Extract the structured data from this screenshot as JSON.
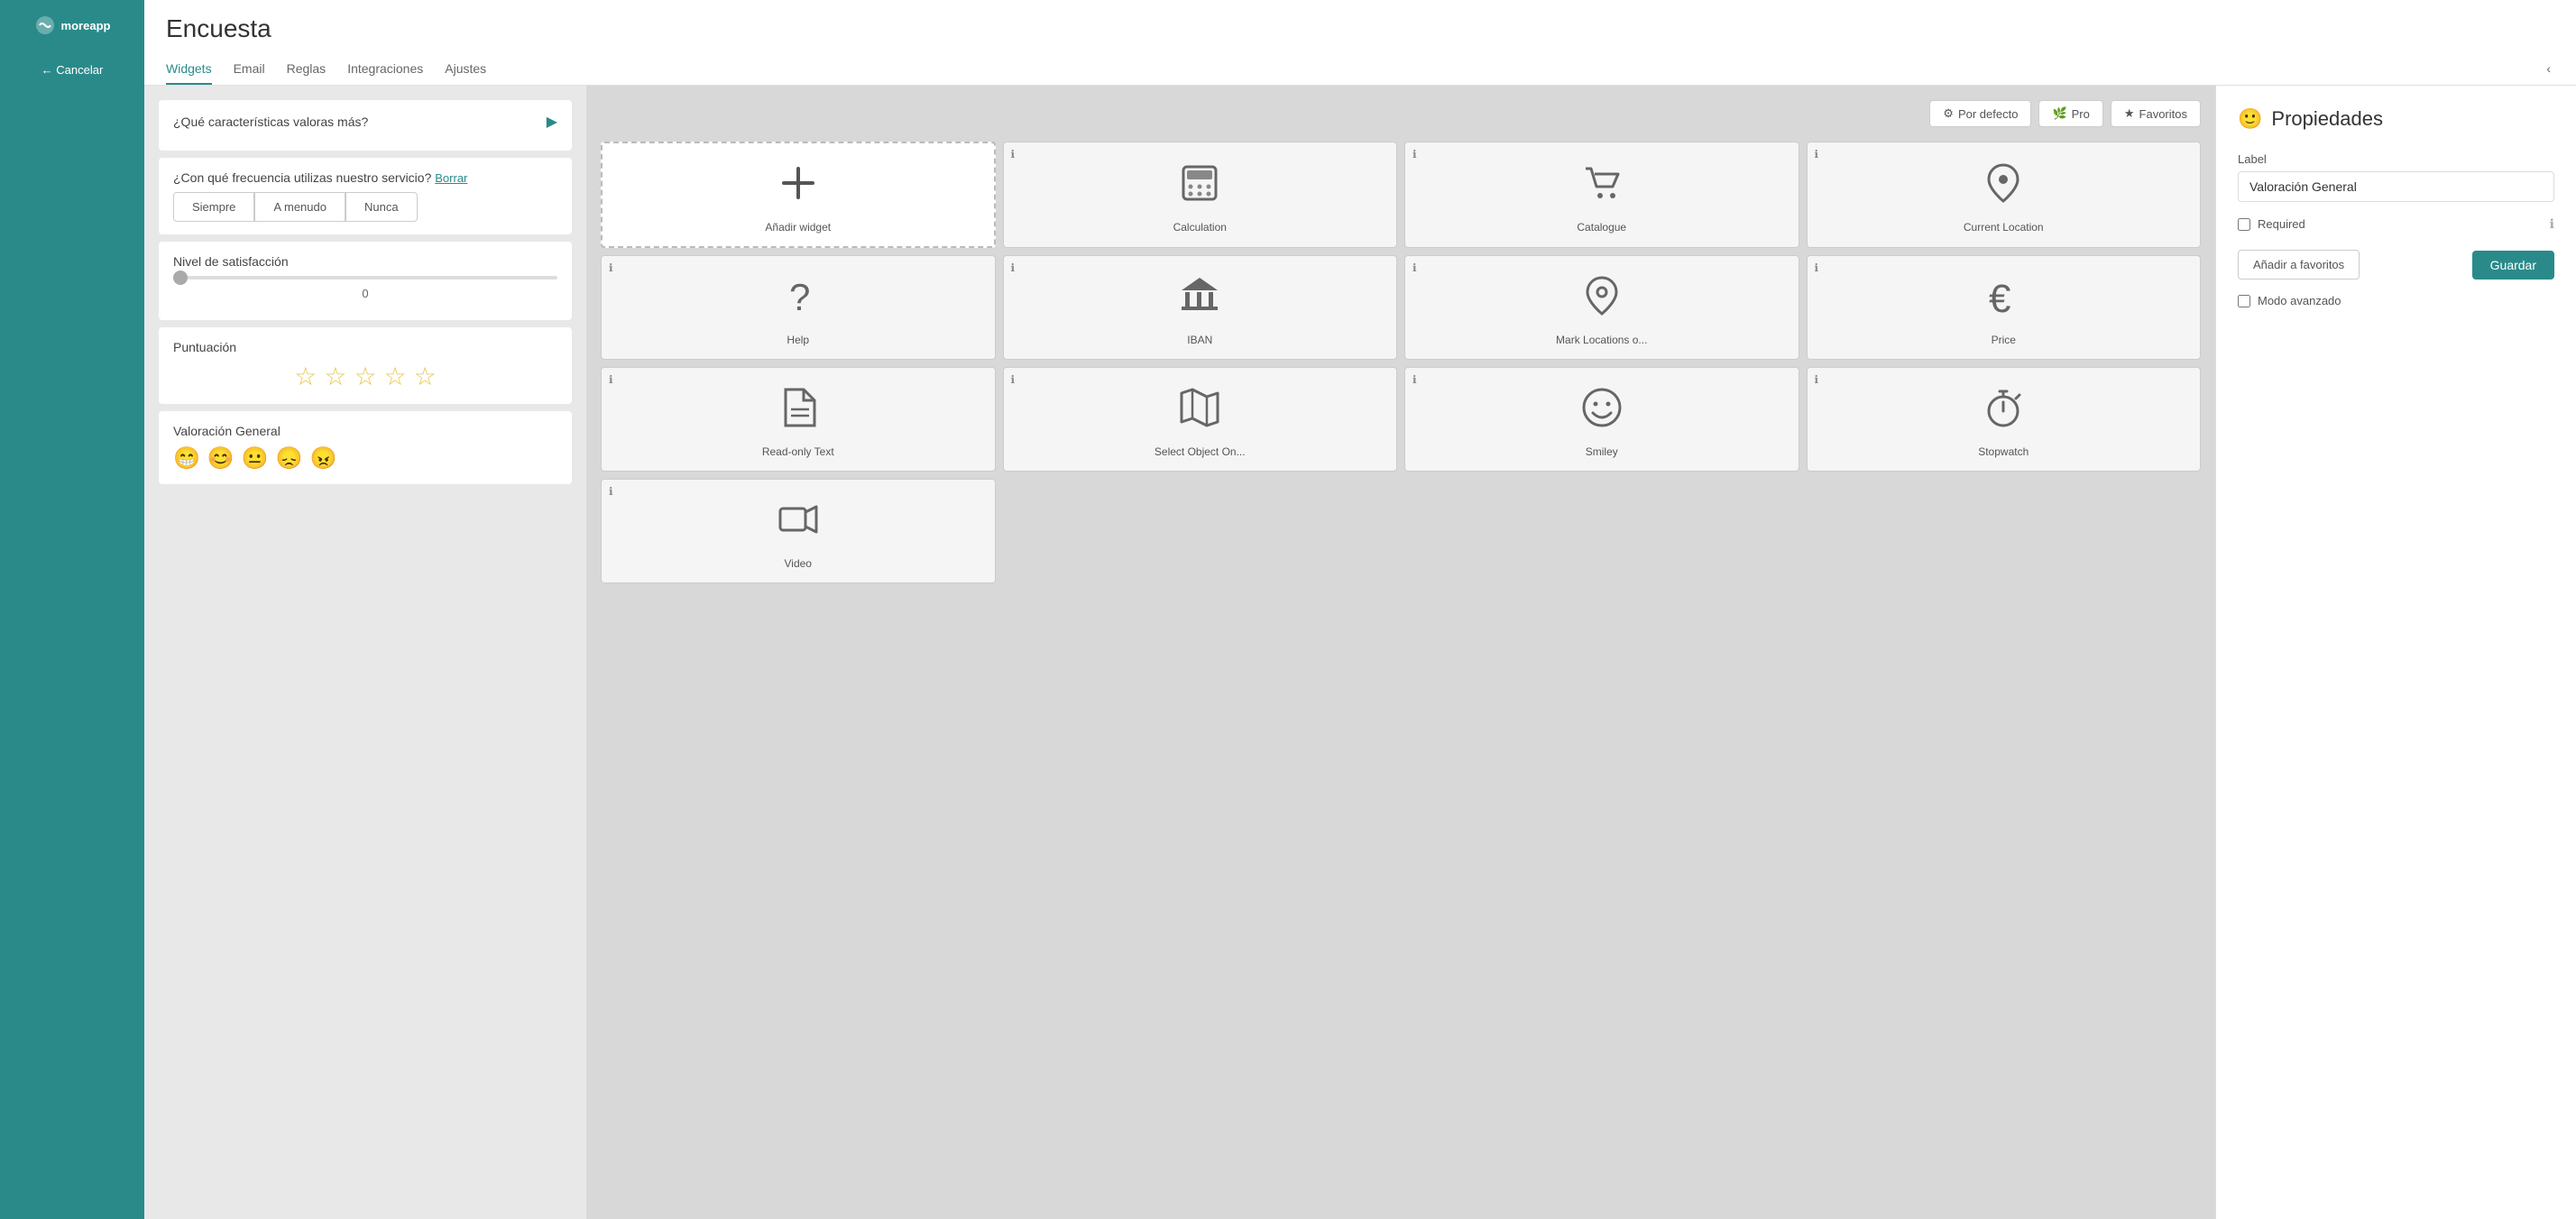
{
  "app": {
    "logo_text": "moreapp",
    "page_title": "Encuesta"
  },
  "sidebar": {
    "cancel_label": "← Cancelar"
  },
  "tabs": [
    {
      "id": "widgets",
      "label": "Widgets",
      "active": true
    },
    {
      "id": "email",
      "label": "Email",
      "active": false
    },
    {
      "id": "reglas",
      "label": "Reglas",
      "active": false
    },
    {
      "id": "integraciones",
      "label": "Integraciones",
      "active": false
    },
    {
      "id": "ajustes",
      "label": "Ajustes",
      "active": false
    }
  ],
  "form_items": [
    {
      "id": "caracteristicas",
      "label": "¿Qué características valoras más?",
      "type": "arrow"
    },
    {
      "id": "frecuencia",
      "label": "¿Con qué frecuencia utilizas nuestro servicio?",
      "action": "Borrar",
      "options": [
        "Siempre",
        "A menudo",
        "Nunca"
      ]
    },
    {
      "id": "satisfaccion",
      "label": "Nivel de satisfacción",
      "type": "slider",
      "value": "0"
    },
    {
      "id": "puntuacion",
      "label": "Puntuación",
      "type": "stars",
      "star_count": 5
    },
    {
      "id": "valoracion",
      "label": "Valoración General",
      "type": "smiley",
      "smileys": [
        "😁",
        "😊",
        "😐",
        "😞",
        "😠"
      ]
    }
  ],
  "widget_toolbar": {
    "por_defecto": "Por defecto",
    "pro": "Pro",
    "favoritos": "Favoritos"
  },
  "widgets": [
    {
      "id": "add",
      "label": "Añadir widget",
      "icon": "plus",
      "dashed": true
    },
    {
      "id": "calculation",
      "label": "Calculation",
      "icon": "calc"
    },
    {
      "id": "catalogue",
      "label": "Catalogue",
      "icon": "cart"
    },
    {
      "id": "current_location",
      "label": "Current Location",
      "icon": "pin"
    },
    {
      "id": "help",
      "label": "Help",
      "icon": "question"
    },
    {
      "id": "iban",
      "label": "IBAN",
      "icon": "bank"
    },
    {
      "id": "mark_locations",
      "label": "Mark Locations o...",
      "icon": "location"
    },
    {
      "id": "price",
      "label": "Price",
      "icon": "euro"
    },
    {
      "id": "readonly_text",
      "label": "Read-only Text",
      "icon": "doc"
    },
    {
      "id": "select_object",
      "label": "Select Object On...",
      "icon": "map"
    },
    {
      "id": "smiley",
      "label": "Smiley",
      "icon": "smiley"
    },
    {
      "id": "stopwatch",
      "label": "Stopwatch",
      "icon": "stopwatch"
    },
    {
      "id": "video",
      "label": "Video",
      "icon": "video"
    }
  ],
  "properties": {
    "title": "Propiedades",
    "label_field": "Label",
    "label_value": "Valoración General",
    "required_label": "Required",
    "required_checked": false,
    "add_favorites_btn": "Añadir a favoritos",
    "save_btn": "Guardar",
    "advanced_label": "Modo avanzado",
    "advanced_checked": false
  }
}
